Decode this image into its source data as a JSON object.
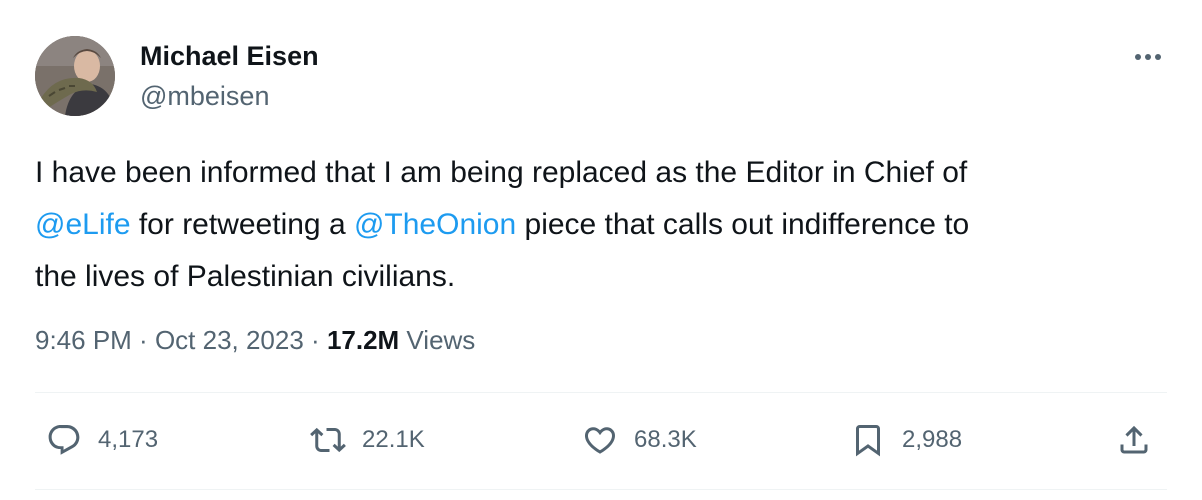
{
  "author": {
    "name": "Michael Eisen",
    "handle": "@mbeisen"
  },
  "tweet": {
    "line1": "I have been informed that I am being replaced as the Editor in Chief of",
    "line2_mention1": "@eLife",
    "line2_text1": " for retweeting a ",
    "line2_mention2": "@TheOnion",
    "line2_text2": " piece that calls out indifference to",
    "line3": "the lives of Palestinian civilians."
  },
  "meta": {
    "time": "9:46 PM",
    "separator1": " · ",
    "date": "Oct 23, 2023",
    "separator2": " · ",
    "views_count": "17.2M",
    "views_label": " Views"
  },
  "actions": {
    "replies": "4,173",
    "retweets": "22.1K",
    "likes": "68.3K",
    "bookmarks": "2,988"
  },
  "icons": {
    "more": "more-horizontal-icon",
    "reply": "reply-bubble-icon",
    "retweet": "retweet-icon",
    "like": "heart-icon",
    "bookmark": "bookmark-icon",
    "share": "share-upload-icon"
  },
  "colors": {
    "text": "#0f1419",
    "secondary": "#536471",
    "link": "#1d9bf0",
    "divider": "#eff3f4"
  }
}
